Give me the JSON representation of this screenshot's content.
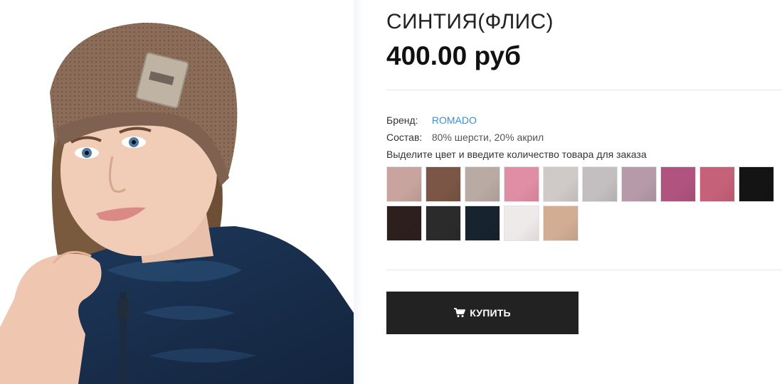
{
  "product": {
    "title": "СИНТИЯ(ФЛИС)",
    "price": "400.00 руб",
    "brand_label": "Бренд:",
    "brand_value": "ROMADO",
    "composition_label": "Состав:",
    "composition_value": "80% шерсти, 20% акрил",
    "instruction": "Выделите цвет и введите количество товара для заказа",
    "buy_label": "КУПИТЬ"
  },
  "colors": {
    "brand_link": "#3a8fd6",
    "buy_button": "#222222",
    "swatches": [
      "#c9a49e",
      "#7b5646",
      "#b9aaa3",
      "#e08ea5",
      "#cfc9c8",
      "#c3bec0",
      "#b69aa9",
      "#b0547f",
      "#c56178",
      "#141414",
      "#2d1f1e",
      "#2b2b2b",
      "#17232e",
      "#eeeae9",
      "#d2ad93"
    ]
  },
  "icons": {
    "cart": "cart-icon"
  }
}
